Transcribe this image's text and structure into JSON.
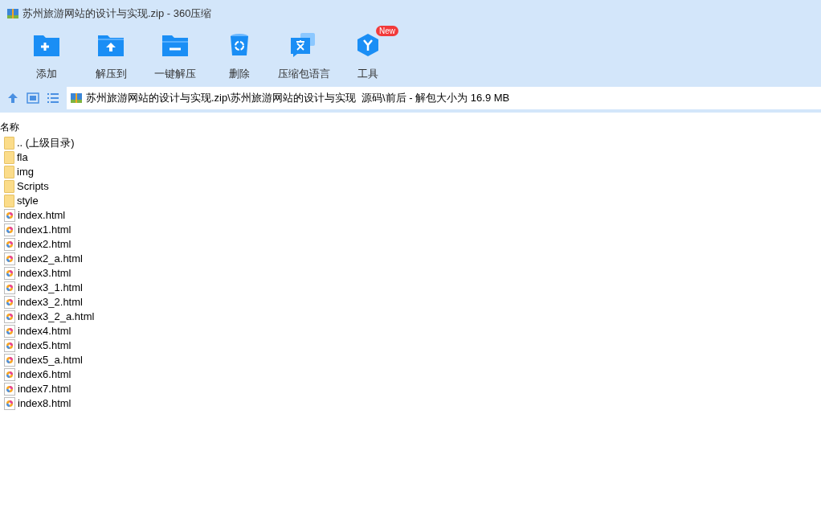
{
  "window": {
    "title": "苏州旅游网站的设计与实现.zip - 360压缩"
  },
  "toolbar": [
    {
      "kind": "add",
      "label": "添加"
    },
    {
      "kind": "extract",
      "label": "解压到"
    },
    {
      "kind": "oneclick",
      "label": "一键解压"
    },
    {
      "kind": "delete",
      "label": "删除"
    },
    {
      "kind": "language",
      "label": "压缩包语言"
    },
    {
      "kind": "tools",
      "label": "工具",
      "badge": "New"
    }
  ],
  "address": {
    "path": "苏州旅游网站的设计与实现.zip\\苏州旅游网站的设计与实现  源码\\前后 - 解包大小为 16.9 MB"
  },
  "table": {
    "columns": [
      "名称"
    ],
    "rows": [
      {
        "kind": "folder",
        "name": ".. (上级目录)"
      },
      {
        "kind": "folder",
        "name": "fla"
      },
      {
        "kind": "folder",
        "name": "img"
      },
      {
        "kind": "folder",
        "name": "Scripts"
      },
      {
        "kind": "folder",
        "name": "style"
      },
      {
        "kind": "html",
        "name": "index.html"
      },
      {
        "kind": "html",
        "name": "index1.html"
      },
      {
        "kind": "html",
        "name": "index2.html"
      },
      {
        "kind": "html",
        "name": "index2_a.html"
      },
      {
        "kind": "html",
        "name": "index3.html"
      },
      {
        "kind": "html",
        "name": "index3_1.html"
      },
      {
        "kind": "html",
        "name": "index3_2.html"
      },
      {
        "kind": "html",
        "name": "index3_2_a.html"
      },
      {
        "kind": "html",
        "name": "index4.html"
      },
      {
        "kind": "html",
        "name": "index5.html"
      },
      {
        "kind": "html",
        "name": "index5_a.html"
      },
      {
        "kind": "html",
        "name": "index6.html"
      },
      {
        "kind": "html",
        "name": "index7.html"
      },
      {
        "kind": "html",
        "name": "index8.html"
      }
    ]
  }
}
